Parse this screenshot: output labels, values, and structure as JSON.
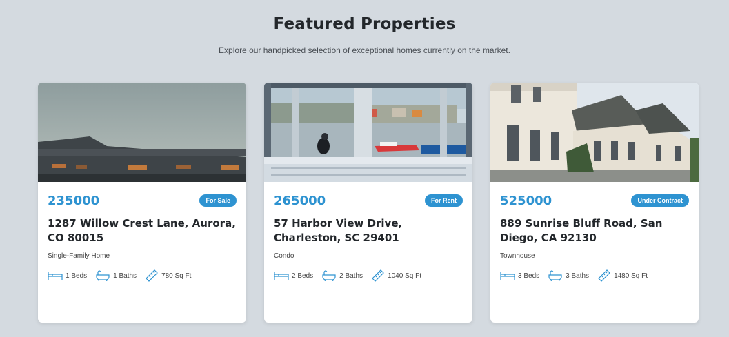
{
  "header": {
    "title": "Featured Properties",
    "subtitle": "Explore our handpicked selection of exceptional homes currently on the market."
  },
  "colors": {
    "accent": "#2e93d1",
    "background": "#d4dae0"
  },
  "properties": [
    {
      "price": "235000",
      "status": "For Sale",
      "address": "1287 Willow Crest Lane, Aurora, CO 80015",
      "type": "Single-Family Home",
      "beds": "1 Beds",
      "baths": "1 Baths",
      "sqft": "780 Sq Ft"
    },
    {
      "price": "265000",
      "status": "For Rent",
      "address": "57 Harbor View Drive, Charleston, SC 29401",
      "type": "Condo",
      "beds": "2 Beds",
      "baths": "2 Baths",
      "sqft": "1040 Sq Ft"
    },
    {
      "price": "525000",
      "status": "Under Contract",
      "address": "889 Sunrise Bluff Road, San Diego, CA 92130",
      "type": "Townhouse",
      "beds": "3 Beds",
      "baths": "3 Baths",
      "sqft": "1480 Sq Ft"
    }
  ],
  "icons": {
    "beds": "bed-icon",
    "baths": "bathtub-icon",
    "sqft": "ruler-icon"
  }
}
